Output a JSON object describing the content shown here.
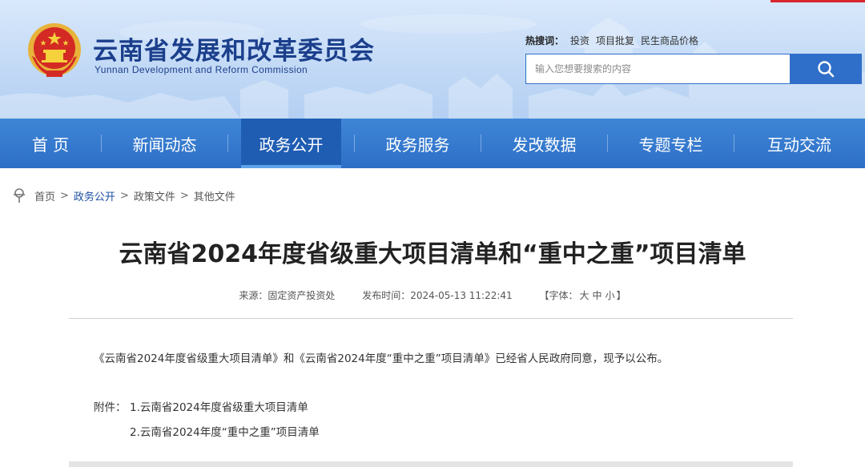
{
  "header": {
    "title": "云南省发展和改革委员会",
    "subtitle": "Yunnan Development and Reform Commission",
    "hot_label": "热搜词：",
    "hot_words": [
      "投资",
      "项目批复",
      "民生商品价格"
    ],
    "search_placeholder": "输入您想要搜索的内容"
  },
  "nav": {
    "items": [
      "首 页",
      "新闻动态",
      "政务公开",
      "政务服务",
      "发改数据",
      "专题专栏",
      "互动交流"
    ],
    "active": "政务公开"
  },
  "breadcrumb": [
    "首页",
    "政务公开",
    "政策文件",
    "其他文件"
  ],
  "article": {
    "title": "云南省2024年度省级重大项目清单和“重中之重”项目清单",
    "source": "来源：固定资产投资处",
    "published": "发布时间：2024-05-13 11:22:41",
    "font_label": "【字体：",
    "font_sizes": [
      "大",
      "中",
      "小"
    ],
    "font_close": "】",
    "body": "《云南省2024年度省级重大项目清单》和《云南省2024年度“重中之重”项目清单》已经省人民政府同意，现予以公布。",
    "attach_label": "附件：",
    "attachments": [
      "1.云南省2024年度省级重大项目清单",
      "2.云南省2024年度“重中之重”项目清单"
    ]
  },
  "colors": {
    "brand": "#1b3f8c",
    "nav": "#2d6fc7",
    "nav_active": "#1f5db3",
    "accent_red": "#d6262b"
  }
}
